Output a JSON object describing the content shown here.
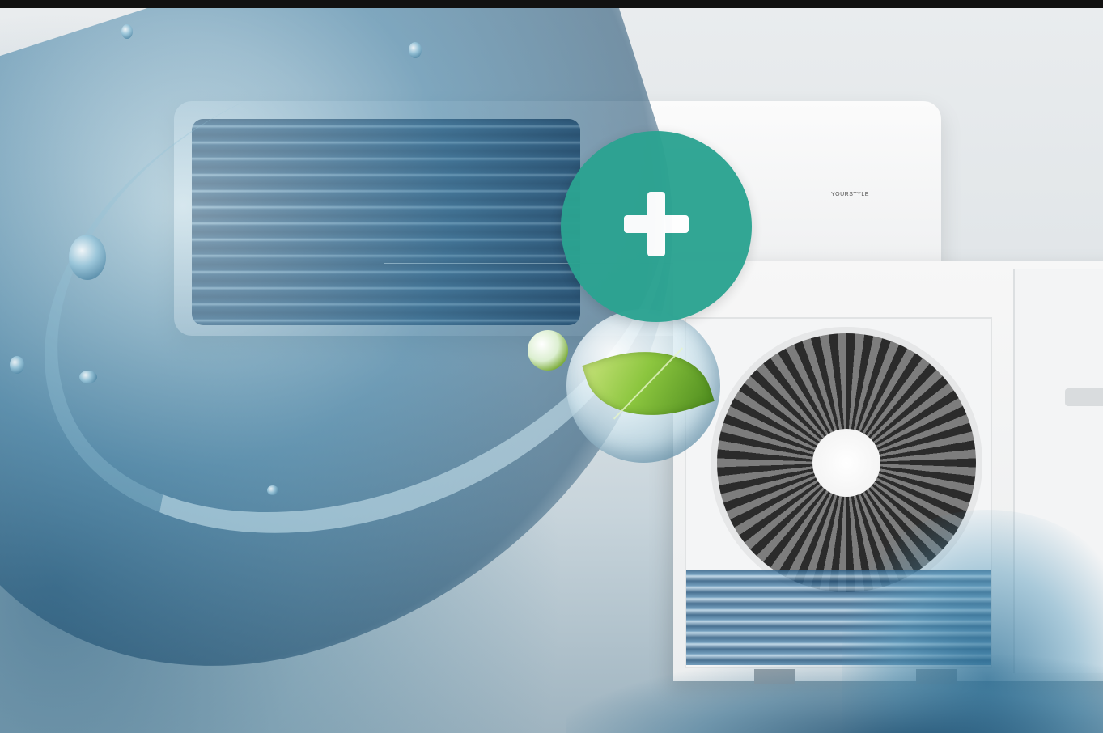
{
  "scene": {
    "description_colors": {
      "accent": "#2ba391",
      "water_dark": "#1d4f72",
      "water_light": "#9cc8dc",
      "leaf": "#8cc63f",
      "unit_white": "#f4f5f6"
    }
  },
  "indoor_unit": {
    "brand_text": "YOURSTYLE"
  },
  "plus_button": {
    "icon": "plus-icon"
  },
  "leaf_bubble": {
    "icon": "leaf-icon"
  }
}
